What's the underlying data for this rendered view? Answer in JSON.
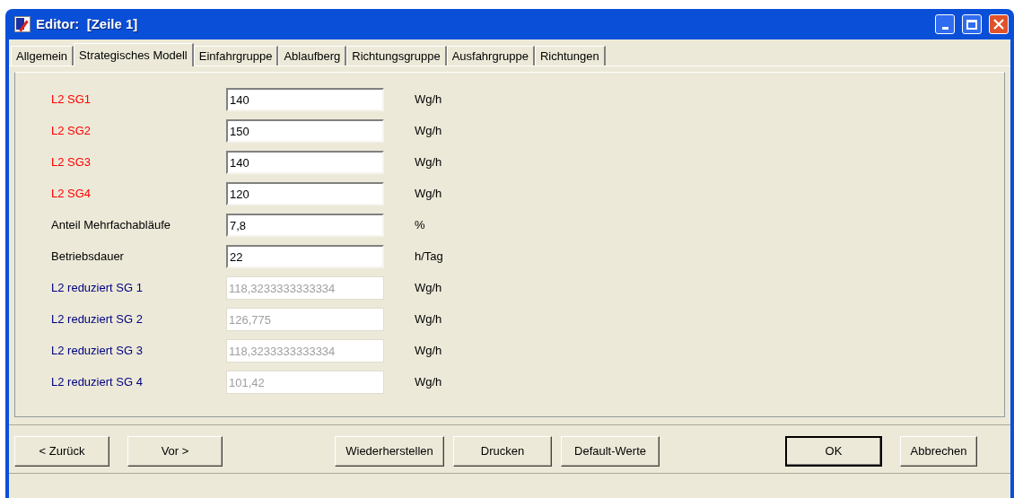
{
  "window": {
    "title": "Editor:  [Zeile 1]"
  },
  "tabs": [
    {
      "label": "Allgemein",
      "selected": false
    },
    {
      "label": "Strategisches Modell",
      "selected": true
    },
    {
      "label": "Einfahrgruppe",
      "selected": false
    },
    {
      "label": "Ablaufberg",
      "selected": false
    },
    {
      "label": "Richtungsgruppe",
      "selected": false
    },
    {
      "label": "Ausfahrgruppe",
      "selected": false
    },
    {
      "label": "Richtungen",
      "selected": false
    }
  ],
  "fields": [
    {
      "label": "L2 SG1",
      "color": "#ff0000",
      "value": "140",
      "unit": "Wg/h",
      "disabled": false
    },
    {
      "label": "L2 SG2",
      "color": "#ff0000",
      "value": "150",
      "unit": "Wg/h",
      "disabled": false
    },
    {
      "label": "L2 SG3",
      "color": "#ff0000",
      "value": "140",
      "unit": "Wg/h",
      "disabled": false
    },
    {
      "label": "L2 SG4",
      "color": "#ff0000",
      "value": "120",
      "unit": "Wg/h",
      "disabled": false
    },
    {
      "label": "Anteil Mehrfachabläufe",
      "color": "#000000",
      "value": "7,8",
      "unit": "%",
      "disabled": false
    },
    {
      "label": "Betriebsdauer",
      "color": "#000000",
      "value": "22",
      "unit": "h/Tag",
      "disabled": false
    },
    {
      "label": "L2 reduziert SG 1",
      "color": "#000080",
      "value": "118,3233333333334",
      "unit": "Wg/h",
      "disabled": true
    },
    {
      "label": "L2 reduziert SG 2",
      "color": "#000080",
      "value": "126,775",
      "unit": "Wg/h",
      "disabled": true
    },
    {
      "label": "L2 reduziert SG 3",
      "color": "#000080",
      "value": "118,3233333333334",
      "unit": "Wg/h",
      "disabled": true
    },
    {
      "label": "L2 reduziert SG 4",
      "color": "#000080",
      "value": "101,42",
      "unit": "Wg/h",
      "disabled": true
    }
  ],
  "buttons": [
    {
      "label": "< Zurück",
      "default": false
    },
    {
      "label": "Vor >",
      "default": false
    },
    {
      "label": "Wiederherstellen",
      "default": false
    },
    {
      "label": "Drucken",
      "default": false
    },
    {
      "label": "Default-Werte",
      "default": false
    },
    {
      "label": "OK",
      "default": true
    },
    {
      "label": "Abbrechen",
      "default": false
    }
  ]
}
